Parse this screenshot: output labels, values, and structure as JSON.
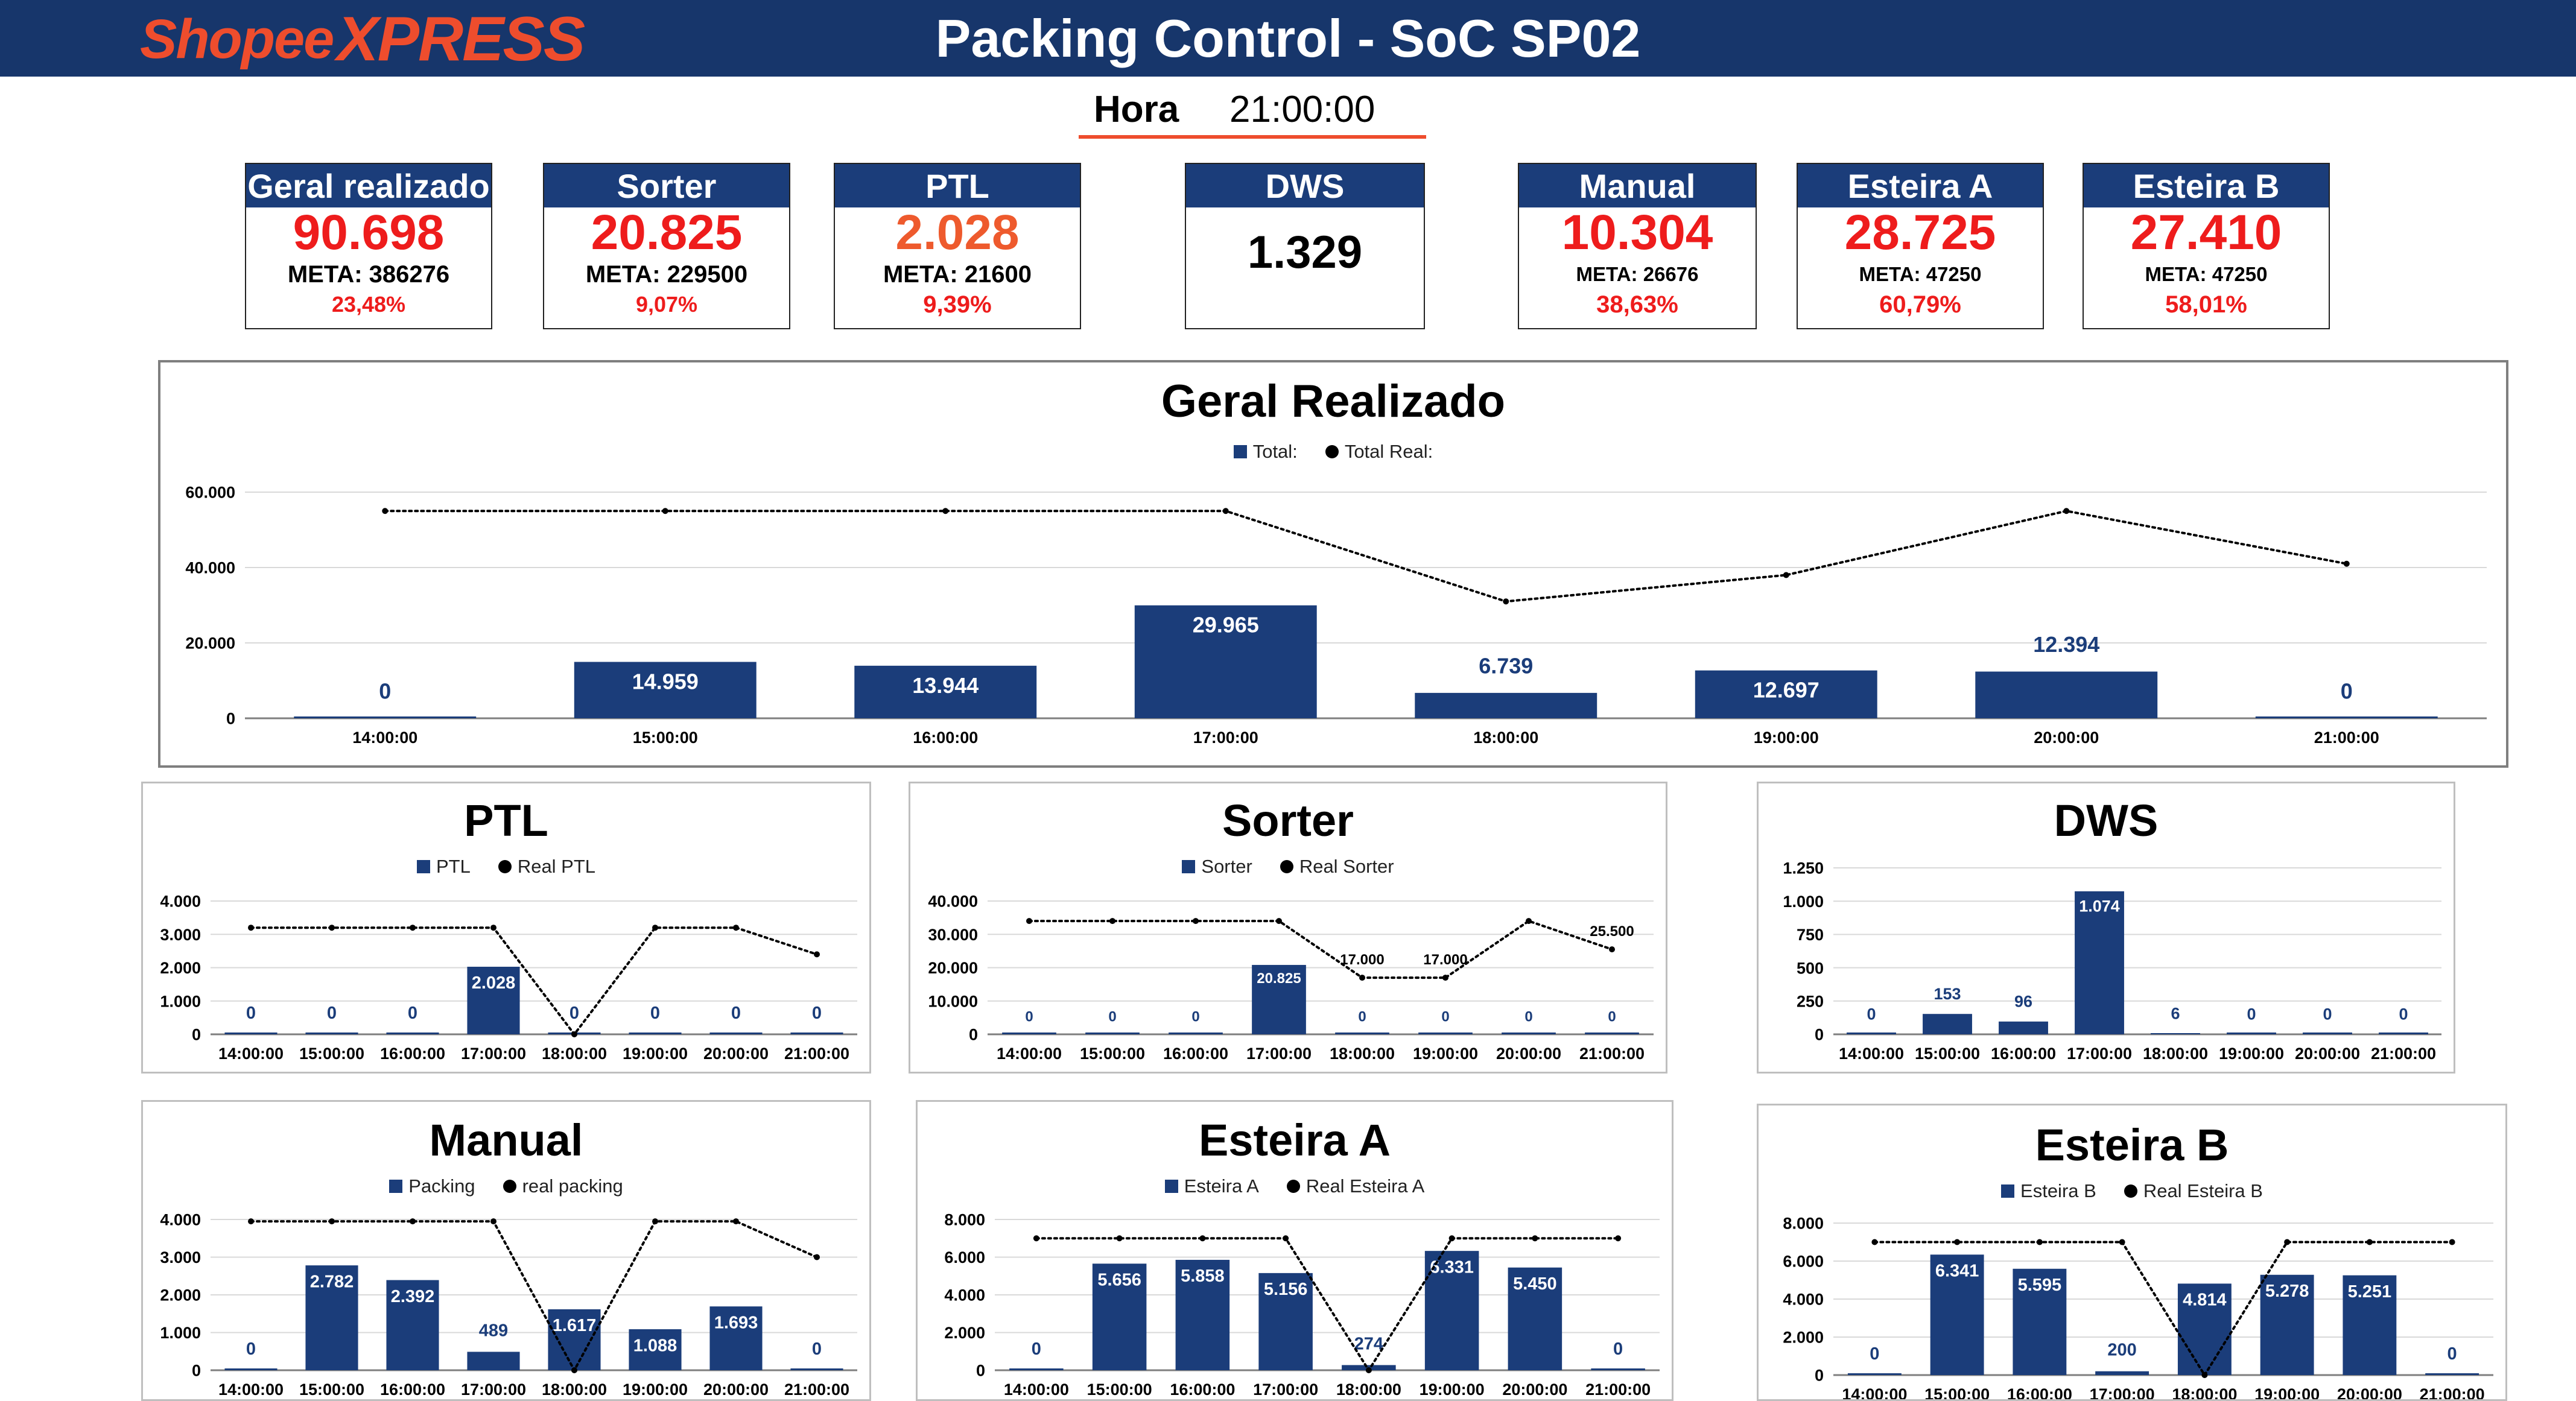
{
  "header": {
    "logo_part1": "Shopee",
    "logo_part2": "XPRESS",
    "title": "Packing Control - SoC SP02",
    "hora_label": "Hora",
    "hora_value": "21:00:00"
  },
  "colors": {
    "header_bg": "#17366b",
    "bar": "#1b3d7a",
    "accent": "#ee4d2d",
    "alert": "#ee1c1c"
  },
  "kpis": [
    {
      "label": "Geral realizado",
      "value": "90.698",
      "meta": "META: 386276",
      "pct": "23,48%"
    },
    {
      "label": "Sorter",
      "value": "20.825",
      "meta": "META: 229500",
      "pct": "9,07%"
    },
    {
      "label": "PTL",
      "value": "2.028",
      "meta": "META: 21600",
      "pct": "9,39%"
    },
    {
      "label": "DWS",
      "value": "1.329"
    },
    {
      "label": "Manual",
      "value": "10.304",
      "meta": "META: 26676",
      "pct": "38,63%"
    },
    {
      "label": "Esteira A",
      "value": "28.725",
      "meta": "META: 47250",
      "pct": "60,79%"
    },
    {
      "label": "Esteira B",
      "value": "27.410",
      "meta": "META: 47250",
      "pct": "58,01%"
    }
  ],
  "chart_data": [
    {
      "id": "geral",
      "type": "bar",
      "title": "Geral Realizado",
      "categories": [
        "14:00:00",
        "15:00:00",
        "16:00:00",
        "17:00:00",
        "18:00:00",
        "19:00:00",
        "20:00:00",
        "21:00:00"
      ],
      "series": [
        {
          "name": "Total:",
          "type": "bar",
          "values": [
            0,
            14959,
            13944,
            29965,
            6739,
            12697,
            12394,
            0
          ],
          "labels": [
            "0",
            "14.959",
            "13.944",
            "29.965",
            "6.739",
            "12.697",
            "12.394",
            "0"
          ]
        },
        {
          "name": "Total Real:",
          "type": "line",
          "values": [
            55000,
            55000,
            55000,
            55000,
            31000,
            38000,
            55000,
            41000
          ]
        }
      ],
      "ylim": [
        0,
        60000
      ],
      "yticks": [
        0,
        20000,
        40000,
        60000
      ],
      "ytick_labels": [
        "0",
        "20.000",
        "40.000",
        "60.000"
      ],
      "legend": "top-center",
      "grid": true
    },
    {
      "id": "ptl",
      "type": "bar",
      "title": "PTL",
      "categories": [
        "14:00:00",
        "15:00:00",
        "16:00:00",
        "17:00:00",
        "18:00:00",
        "19:00:00",
        "20:00:00",
        "21:00:00"
      ],
      "series": [
        {
          "name": "PTL",
          "type": "bar",
          "values": [
            0,
            0,
            0,
            2028,
            0,
            0,
            0,
            0
          ],
          "labels": [
            "0",
            "0",
            "0",
            "2.028",
            "0",
            "0",
            "0",
            "0"
          ]
        },
        {
          "name": "Real PTL",
          "type": "line",
          "values": [
            3200,
            3200,
            3200,
            3200,
            0,
            3200,
            3200,
            2400
          ]
        }
      ],
      "ylim": [
        0,
        4000
      ],
      "yticks": [
        0,
        1000,
        2000,
        3000,
        4000
      ],
      "ytick_labels": [
        "0",
        "1.000",
        "2.000",
        "3.000",
        "4.000"
      ],
      "legend": "top-center",
      "grid": true
    },
    {
      "id": "sorter",
      "type": "bar",
      "title": "Sorter",
      "categories": [
        "14:00:00",
        "15:00:00",
        "16:00:00",
        "17:00:00",
        "18:00:00",
        "19:00:00",
        "20:00:00",
        "21:00:00"
      ],
      "series": [
        {
          "name": "Sorter",
          "type": "bar",
          "values": [
            0,
            0,
            0,
            20825,
            0,
            0,
            0,
            0
          ],
          "labels": [
            "0",
            "0",
            "0",
            "20.825",
            "0",
            "0",
            "0",
            "0"
          ]
        },
        {
          "name": "Real Sorter",
          "type": "line",
          "values": [
            34000,
            34000,
            34000,
            34000,
            17000,
            17000,
            34000,
            25500
          ],
          "labels": [
            "",
            "",
            "",
            "",
            "17.000",
            "17.000",
            "",
            "25.500"
          ]
        }
      ],
      "ylim": [
        0,
        40000
      ],
      "yticks": [
        0,
        10000,
        20000,
        30000,
        40000
      ],
      "ytick_labels": [
        "0",
        "10.000",
        "20.000",
        "30.000",
        "40.000"
      ],
      "legend": "top-center",
      "grid": true
    },
    {
      "id": "dws",
      "type": "bar",
      "title": "DWS",
      "categories": [
        "14:00:00",
        "15:00:00",
        "16:00:00",
        "17:00:00",
        "18:00:00",
        "19:00:00",
        "20:00:00",
        "21:00:00"
      ],
      "series": [
        {
          "name": "DWS",
          "type": "bar",
          "values": [
            0,
            153,
            96,
            1074,
            6,
            0,
            0,
            0
          ],
          "labels": [
            "0",
            "153",
            "96",
            "1.074",
            "6",
            "0",
            "0",
            "0"
          ]
        }
      ],
      "ylim": [
        0,
        1250
      ],
      "yticks": [
        0,
        250,
        500,
        750,
        1000,
        1250
      ],
      "ytick_labels": [
        "0",
        "250",
        "500",
        "750",
        "1.000",
        "1.250"
      ],
      "grid": true
    },
    {
      "id": "manual",
      "type": "bar",
      "title": "Manual",
      "categories": [
        "14:00:00",
        "15:00:00",
        "16:00:00",
        "17:00:00",
        "18:00:00",
        "19:00:00",
        "20:00:00",
        "21:00:00"
      ],
      "series": [
        {
          "name": "Packing",
          "type": "bar",
          "values": [
            0,
            2782,
            2392,
            489,
            1617,
            1088,
            1693,
            0
          ],
          "labels": [
            "0",
            "2.782",
            "2.392",
            "489",
            "1.617",
            "1.088",
            "1.693",
            "0"
          ]
        },
        {
          "name": "real packing",
          "type": "line",
          "values": [
            3950,
            3950,
            3950,
            3950,
            0,
            3950,
            3950,
            3000
          ]
        }
      ],
      "ylim": [
        0,
        4000
      ],
      "yticks": [
        0,
        1000,
        2000,
        3000,
        4000
      ],
      "ytick_labels": [
        "0",
        "1.000",
        "2.000",
        "3.000",
        "4.000"
      ],
      "legend": "top-center",
      "grid": true
    },
    {
      "id": "esteira-a",
      "type": "bar",
      "title": "Esteira A",
      "categories": [
        "14:00:00",
        "15:00:00",
        "16:00:00",
        "17:00:00",
        "18:00:00",
        "19:00:00",
        "20:00:00",
        "21:00:00"
      ],
      "series": [
        {
          "name": "Esteira A",
          "type": "bar",
          "values": [
            0,
            5656,
            5858,
            5156,
            274,
            6331,
            5450,
            0
          ],
          "labels": [
            "0",
            "5.656",
            "5.858",
            "5.156",
            "274",
            "6.331",
            "5.450",
            "0"
          ]
        },
        {
          "name": "Real Esteira A",
          "type": "line",
          "values": [
            7000,
            7000,
            7000,
            7000,
            0,
            7000,
            7000,
            7000
          ]
        }
      ],
      "ylim": [
        0,
        8000
      ],
      "yticks": [
        0,
        2000,
        4000,
        6000,
        8000
      ],
      "ytick_labels": [
        "0",
        "2.000",
        "4.000",
        "6.000",
        "8.000"
      ],
      "legend": "top-center",
      "grid": true
    },
    {
      "id": "esteira-b",
      "type": "bar",
      "title": "Esteira B",
      "categories": [
        "14:00:00",
        "15:00:00",
        "16:00:00",
        "17:00:00",
        "18:00:00",
        "19:00:00",
        "20:00:00",
        "21:00:00"
      ],
      "series": [
        {
          "name": "Esteira B",
          "type": "bar",
          "values": [
            0,
            6341,
            5595,
            200,
            4814,
            5278,
            5251,
            0
          ],
          "labels": [
            "0",
            "6.341",
            "5.595",
            "200",
            "4.814",
            "5.278",
            "5.251",
            "0"
          ]
        },
        {
          "name": "Real Esteira B",
          "type": "line",
          "values": [
            7000,
            7000,
            7000,
            7000,
            0,
            7000,
            7000,
            7000
          ]
        }
      ],
      "ylim": [
        0,
        8000
      ],
      "yticks": [
        0,
        2000,
        4000,
        6000,
        8000
      ],
      "ytick_labels": [
        "0",
        "2.000",
        "4.000",
        "6.000",
        "8.000"
      ],
      "legend": "top-center",
      "grid": true
    }
  ]
}
